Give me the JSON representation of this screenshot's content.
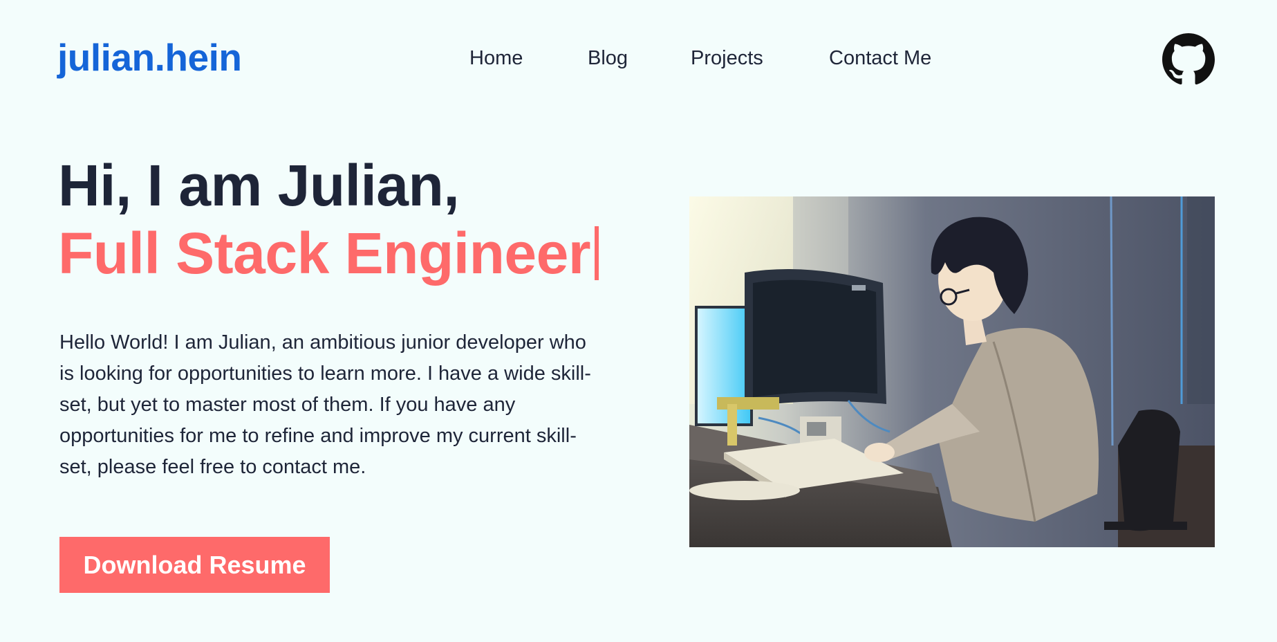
{
  "header": {
    "logo": "julian.hein",
    "nav": [
      {
        "label": "Home"
      },
      {
        "label": "Blog"
      },
      {
        "label": "Projects"
      },
      {
        "label": "Contact Me"
      }
    ],
    "github_icon": "github-icon"
  },
  "hero": {
    "greeting": "Hi, I am Julian,",
    "role": "Full Stack Engineer",
    "bio": "Hello World! I am Julian, an ambitious junior developer who is looking for opportunities to learn more. I have a wide skill-set, but yet to master most of them. If you have any opportunities for me to refine and improve my current skill-set, please feel free to contact me.",
    "cta_label": "Download Resume",
    "illustration": "anime-style developer typing at a computer desk"
  },
  "colors": {
    "background": "#f3fdfc",
    "brand": "#1565d8",
    "accent": "#fe6a6a",
    "text": "#1e2538"
  }
}
